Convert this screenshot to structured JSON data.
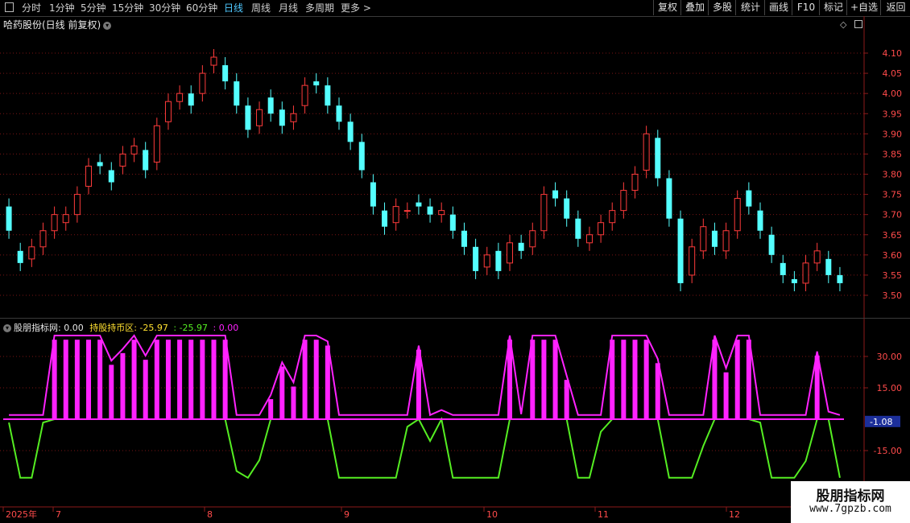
{
  "toolbar": {
    "periods": [
      "分时",
      "1分钟",
      "5分钟",
      "15分钟",
      "30分钟",
      "60分钟",
      "日线",
      "周线",
      "月线",
      "多周期",
      "更多 >"
    ],
    "active_period": "日线",
    "buttons": [
      "复权",
      "叠加",
      "多股",
      "统计",
      "画线",
      "F10",
      "标记",
      "+自选",
      "返回"
    ],
    "menu_icon": "menu-icon"
  },
  "main_chart": {
    "title": "哈药股份(日线 前复权)",
    "y_ticks": [
      "4.10",
      "4.05",
      "4.00",
      "3.95",
      "3.90",
      "3.85",
      "3.80",
      "3.75",
      "3.70",
      "3.65",
      "3.60",
      "3.55",
      "3.50"
    ],
    "up_color": "#ff3b3b",
    "down_color": "#54ffff"
  },
  "indicator": {
    "name": "股朋指标网",
    "val1": ": 0.00",
    "label2": "持股持币区",
    "val2": ": -25.97",
    "val3": ": -25.97",
    "val4": ": 0.00",
    "y_ticks": [
      "30.00",
      "15.00",
      "-15.00"
    ],
    "current_value": "-1.08",
    "colors": {
      "magenta": "#ff22ff",
      "green": "#55ee22",
      "yellow": "#ffe030"
    }
  },
  "x_axis": {
    "labels": [
      "2025年",
      "7",
      "8",
      "9",
      "10",
      "11",
      "12"
    ]
  },
  "watermark": {
    "line1": "股朋指标网",
    "line2": "www.7gpzb.com"
  },
  "chart_data": {
    "type": "candlestick",
    "title": "哈药股份(日线 前复权)",
    "ylim": [
      3.48,
      4.14
    ],
    "x_months": [
      "7",
      "8",
      "9",
      "10",
      "11",
      "12"
    ],
    "ohlc_open_close_approx": [
      [
        3.72,
        3.66
      ],
      [
        3.61,
        3.58
      ],
      [
        3.59,
        3.62
      ],
      [
        3.62,
        3.66
      ],
      [
        3.66,
        3.7
      ],
      [
        3.68,
        3.7
      ],
      [
        3.7,
        3.75
      ],
      [
        3.77,
        3.82
      ],
      [
        3.83,
        3.82
      ],
      [
        3.81,
        3.78
      ],
      [
        3.82,
        3.85
      ],
      [
        3.85,
        3.87
      ],
      [
        3.86,
        3.81
      ],
      [
        3.83,
        3.92
      ],
      [
        3.93,
        3.98
      ],
      [
        3.98,
        4.0
      ],
      [
        4.0,
        3.97
      ],
      [
        4.0,
        4.05
      ],
      [
        4.07,
        4.09
      ],
      [
        4.07,
        4.03
      ],
      [
        4.03,
        3.97
      ],
      [
        3.97,
        3.91
      ],
      [
        3.92,
        3.96
      ],
      [
        3.99,
        3.95
      ],
      [
        3.96,
        3.92
      ],
      [
        3.93,
        3.95
      ],
      [
        3.97,
        4.02
      ],
      [
        4.03,
        4.02
      ],
      [
        4.02,
        3.97
      ],
      [
        3.97,
        3.93
      ],
      [
        3.93,
        3.88
      ],
      [
        3.88,
        3.81
      ],
      [
        3.78,
        3.72
      ],
      [
        3.71,
        3.67
      ],
      [
        3.68,
        3.72
      ],
      [
        3.71,
        3.71
      ],
      [
        3.73,
        3.72
      ],
      [
        3.72,
        3.7
      ],
      [
        3.7,
        3.71
      ],
      [
        3.7,
        3.66
      ],
      [
        3.66,
        3.62
      ],
      [
        3.62,
        3.56
      ],
      [
        3.57,
        3.6
      ],
      [
        3.61,
        3.56
      ],
      [
        3.58,
        3.63
      ],
      [
        3.63,
        3.61
      ],
      [
        3.62,
        3.66
      ],
      [
        3.66,
        3.75
      ],
      [
        3.76,
        3.74
      ],
      [
        3.74,
        3.69
      ],
      [
        3.69,
        3.64
      ],
      [
        3.63,
        3.65
      ],
      [
        3.65,
        3.68
      ],
      [
        3.68,
        3.71
      ],
      [
        3.71,
        3.76
      ],
      [
        3.76,
        3.8
      ],
      [
        3.81,
        3.9
      ],
      [
        3.89,
        3.79
      ],
      [
        3.79,
        3.69
      ],
      [
        3.69,
        3.53
      ],
      [
        3.55,
        3.62
      ],
      [
        3.61,
        3.67
      ],
      [
        3.66,
        3.62
      ],
      [
        3.61,
        3.66
      ],
      [
        3.66,
        3.74
      ],
      [
        3.76,
        3.72
      ],
      [
        3.71,
        3.66
      ],
      [
        3.65,
        3.6
      ],
      [
        3.58,
        3.55
      ],
      [
        3.54,
        3.53
      ],
      [
        3.53,
        3.58
      ],
      [
        3.58,
        3.61
      ],
      [
        3.59,
        3.55
      ],
      [
        3.55,
        3.53
      ]
    ],
    "indicator_series": [
      {
        "name": "股朋指标网",
        "range": [
          -28,
          40
        ]
      }
    ]
  }
}
